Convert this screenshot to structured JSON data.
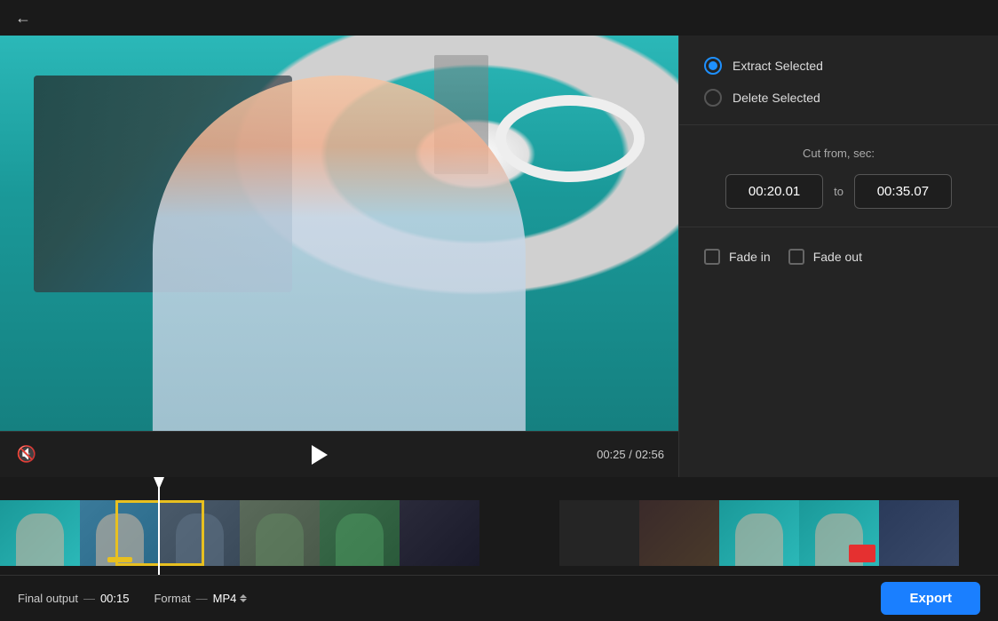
{
  "topbar": {
    "back_label": "‹"
  },
  "options": {
    "extract_label": "Extract Selected",
    "delete_label": "Delete Selected",
    "extract_selected": true
  },
  "cut": {
    "label": "Cut from, sec:",
    "from": "00:20.01",
    "to_word": "to",
    "to": "00:35.07"
  },
  "fade": {
    "fade_in_label": "Fade in",
    "fade_out_label": "Fade out",
    "fade_in_checked": false,
    "fade_out_checked": false
  },
  "player": {
    "current_time": "00:25",
    "total_time": "02:56",
    "time_display": "00:25 / 02:56"
  },
  "bottombar": {
    "final_output_label": "Final output",
    "dash": "—",
    "duration": "00:15",
    "format_label": "Format",
    "format_value": "MP4",
    "export_label": "Export"
  },
  "timeline": {
    "thumbs": [
      {
        "id": 1,
        "class": "thumb-1"
      },
      {
        "id": 2,
        "class": "thumb-2"
      },
      {
        "id": 3,
        "class": "thumb-3"
      },
      {
        "id": 4,
        "class": "thumb-4"
      },
      {
        "id": 5,
        "class": "thumb-5"
      },
      {
        "id": 6,
        "class": "thumb-6"
      },
      {
        "id": 7,
        "class": "thumb-7"
      },
      {
        "id": 8,
        "class": "thumb-8"
      },
      {
        "id": 9,
        "class": "thumb-9"
      },
      {
        "id": 10,
        "class": "thumb-10"
      },
      {
        "id": 11,
        "class": "thumb-11"
      },
      {
        "id": 12,
        "class": "thumb-12"
      }
    ]
  }
}
